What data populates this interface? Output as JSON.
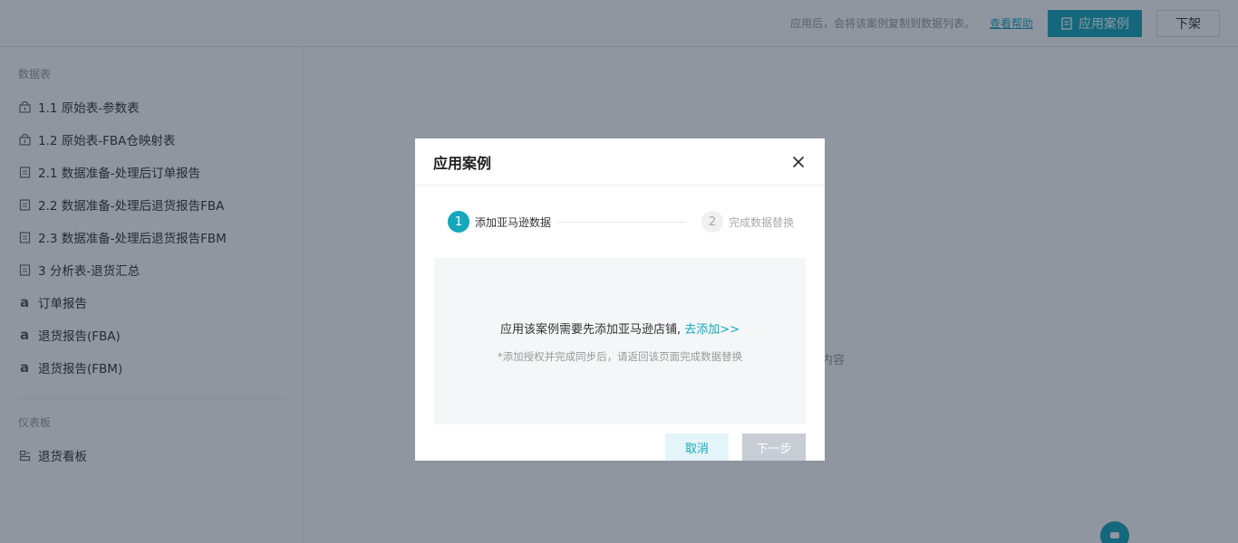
{
  "topbar": {
    "hint": "应用后，会将该案例复制到数据列表。",
    "help_link": "查看帮助",
    "apply_button": "应用案例",
    "off_button": "下架"
  },
  "sidebar": {
    "section1_title": "数据表",
    "items": [
      {
        "label": "1.1 原始表-参数表",
        "icon": "table-lock-icon"
      },
      {
        "label": "1.2 原始表-FBA仓映射表",
        "icon": "table-lock-icon"
      },
      {
        "label": "2.1 数据准备-处理后订单报告",
        "icon": "document-icon"
      },
      {
        "label": "2.2 数据准备-处理后退货报告FBA",
        "icon": "document-icon"
      },
      {
        "label": "2.3 数据准备-处理后退货报告FBM",
        "icon": "document-icon"
      },
      {
        "label": "3 分析表-退货汇总",
        "icon": "document-icon"
      },
      {
        "label": "订单报告",
        "icon": "amazon-icon"
      },
      {
        "label": "退货报告(FBA)",
        "icon": "amazon-icon"
      },
      {
        "label": "退货报告(FBM)",
        "icon": "amazon-icon"
      }
    ],
    "section2_title": "仪表板",
    "dashboard_items": [
      {
        "label": "退货看板",
        "icon": "dashboard-icon"
      }
    ]
  },
  "main": {
    "empty_text": "内容"
  },
  "modal": {
    "title": "应用案例",
    "steps": [
      {
        "num": "1",
        "label": "添加亚马逊数据",
        "state": "active"
      },
      {
        "num": "2",
        "label": "完成数据替换",
        "state": "inactive"
      }
    ],
    "message": "应用该案例需要先添加亚马逊店铺,",
    "message_link": "去添加>>",
    "sub_message": "*添加授权并完成同步后，请返回该页面完成数据替换",
    "cancel_button": "取消",
    "next_button": "下一步"
  },
  "colors": {
    "accent": "#16a7bc",
    "overlay": "rgba(20,35,55,0.48)"
  }
}
